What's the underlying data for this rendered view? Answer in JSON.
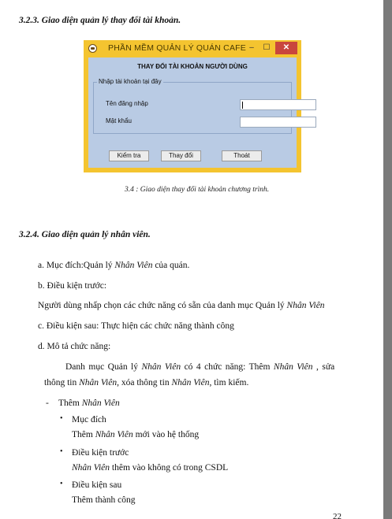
{
  "section_323": {
    "heading": "3.2.3. Giao diện quản lý thay đổi tài khoản."
  },
  "window": {
    "title": "PHẦN MỀM QUẢN LÝ QUÁN CAFE",
    "min_label": "–",
    "max_label": "☐",
    "close_label": "✕",
    "form_title": "THAY ĐỔI TÀI KHOẢN NGƯỜI DÙNG",
    "group_label": "Nhập tài khoản tại đây",
    "username_label": "Tên đăng nhập",
    "username_value": "",
    "password_label": "Mật khẩu",
    "password_value": "",
    "check_button": "Kiểm tra",
    "change_button": "Thay đổi",
    "exit_button": "Thoát"
  },
  "figure_caption": "3.4 : Giao diện thay đổi tài khoản chương trình.",
  "section_324": {
    "heading": "3.2.4. Giao diện quản lý nhân viên."
  },
  "body": {
    "a_prefix": "a. Mục đích:Quản lý ",
    "a_em": "Nhân Viên",
    "a_suffix": " của quán.",
    "b": "b. Điều kiện trước:",
    "b_desc_prefix": "Người dùng nhấp chọn các chức năng có sẵn của danh mục Quản lý ",
    "b_desc_em": "Nhân Viên",
    "c": "c. Điều kiện sau: Thực hiện các chức năng thành công",
    "d": "d. Mô tả chức năng:",
    "d_l1_a": "Danh mục Quản lý ",
    "d_l1_em1": "Nhân Viên",
    "d_l1_b": " có 4 chức năng: Thêm ",
    "d_l1_em2": "Nhân Viên",
    "d_l1_c": " , sửa",
    "d_l2_a": "thông tin ",
    "d_l2_em1": "Nhân Viên",
    "d_l2_b": ", xóa thông tin ",
    "d_l2_em2": "Nhân Viên",
    "d_l2_c": ", tìm kiếm.",
    "dash": "-",
    "add_prefix": "Thêm ",
    "add_em": "Nhân Viên",
    "bullet": "•",
    "purpose_label": "Mục đích",
    "purpose_prefix": "Thêm ",
    "purpose_em": "Nhân Viên",
    "purpose_suffix": "  mới vào hệ thống",
    "pre_label": "Điều kiện trước",
    "pre_em": "Nhân Viên",
    "pre_suffix": "  thêm vào không có trong CSDL",
    "post_label": "Điều kiện sau",
    "post_text": "Thêm thành công"
  },
  "page_number": "22"
}
